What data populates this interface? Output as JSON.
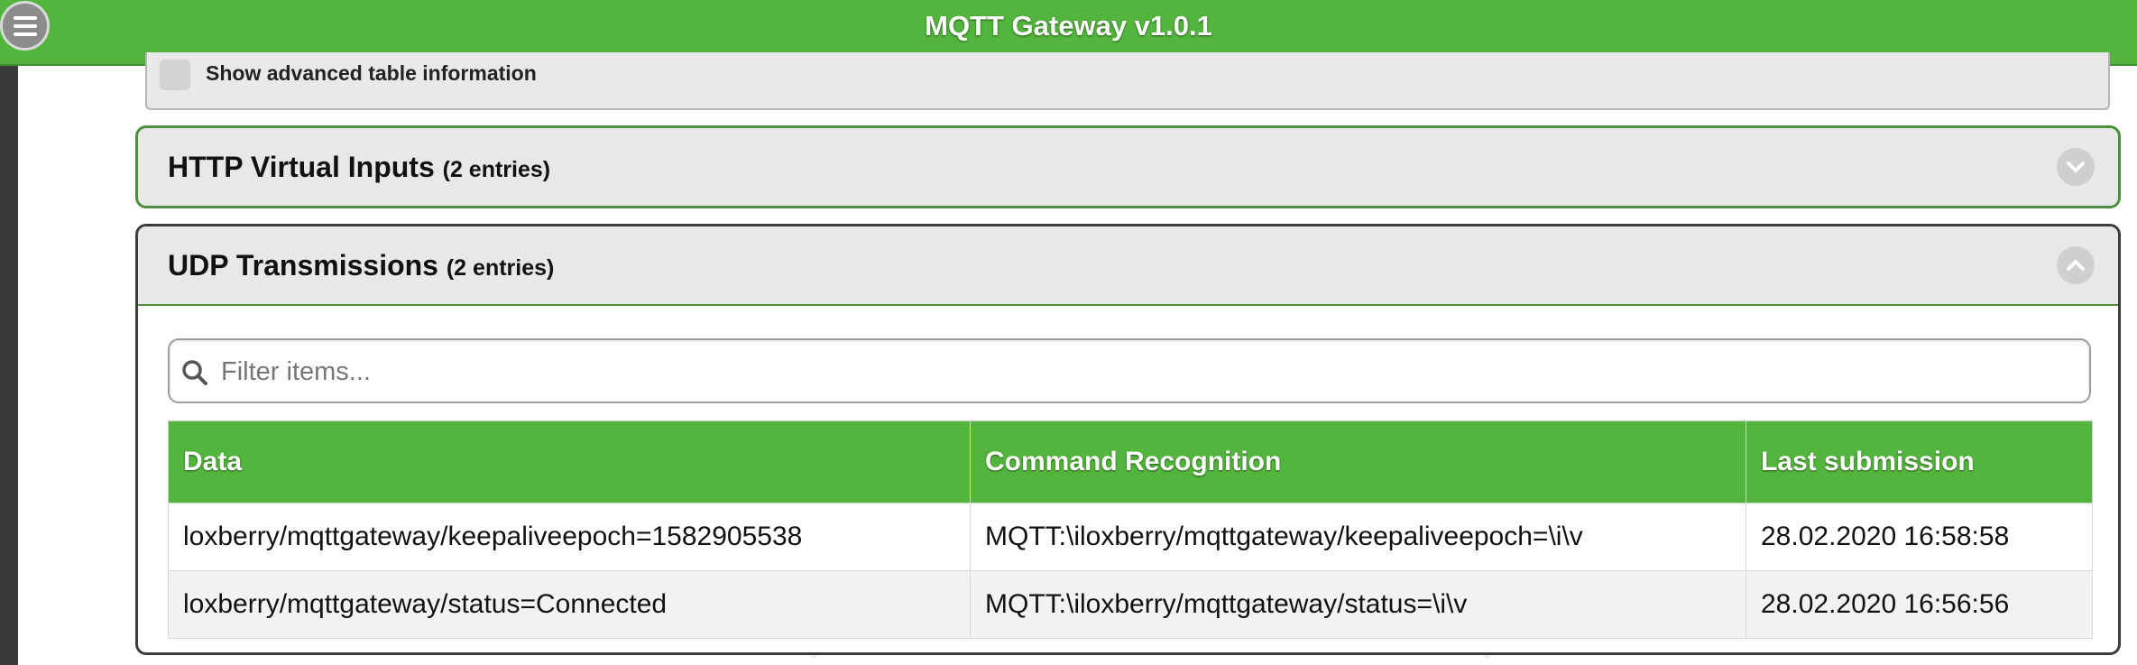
{
  "header": {
    "title": "MQTT Gateway v1.0.1"
  },
  "advanced": {
    "label": "Show advanced table information",
    "checked": false
  },
  "sections": [
    {
      "title": "HTTP Virtual Inputs",
      "count": "(2 entries)",
      "expanded": false
    },
    {
      "title": "UDP Transmissions",
      "count": "(2 entries)",
      "expanded": true
    }
  ],
  "filter": {
    "placeholder": "Filter items...",
    "value": ""
  },
  "table": {
    "headers": [
      "Data",
      "Command Recognition",
      "Last submission"
    ],
    "rows": [
      [
        "loxberry/mqttgateway/keepaliveepoch=1582905538",
        "MQTT:\\iloxberry/mqttgateway/keepaliveepoch=\\i\\v",
        "28.02.2020 16:58:58"
      ],
      [
        "loxberry/mqttgateway/status=Connected",
        "MQTT:\\iloxberry/mqttgateway/status=\\i\\v",
        "28.02.2020 16:56:56"
      ]
    ]
  },
  "colors": {
    "brand_green": "#53b53d",
    "panel_gray": "#e8e8e8",
    "border_green": "#4e8f3e"
  }
}
